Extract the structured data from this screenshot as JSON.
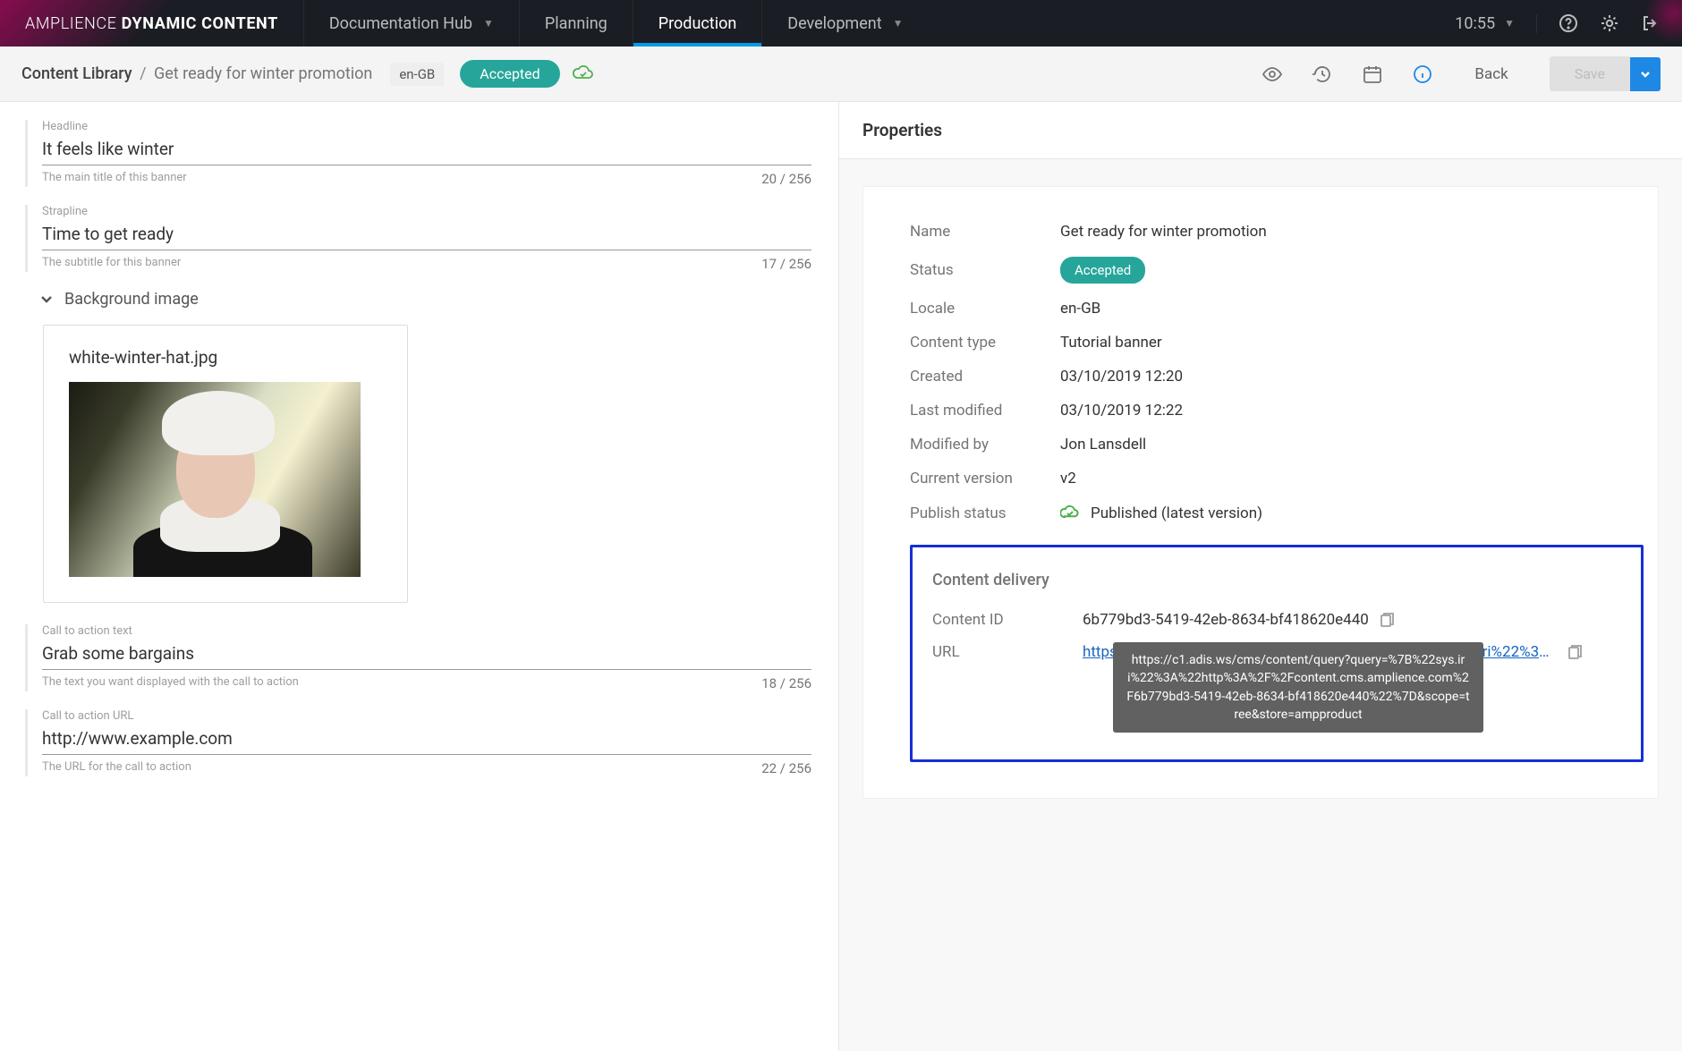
{
  "topnav": {
    "brand_light": "AMPLIENCE",
    "brand_bold": "DYNAMIC CONTENT",
    "items": [
      {
        "label": "Documentation Hub",
        "dropdown": true,
        "active": false
      },
      {
        "label": "Planning",
        "dropdown": false,
        "active": false
      },
      {
        "label": "Production",
        "dropdown": false,
        "active": true
      },
      {
        "label": "Development",
        "dropdown": true,
        "active": false
      }
    ],
    "time": "10:55"
  },
  "subheader": {
    "root": "Content Library",
    "current": "Get ready for winter promotion",
    "locale": "en-GB",
    "status": "Accepted",
    "back_label": "Back",
    "save_label": "Save"
  },
  "form": {
    "headline": {
      "label": "Headline",
      "value": "It feels like winter",
      "help": "The main title of this banner",
      "count": "20 / 256"
    },
    "strapline": {
      "label": "Strapline",
      "value": "Time to get ready",
      "help": "The subtitle for this banner",
      "count": "17 / 256"
    },
    "bgimage": {
      "section_label": "Background image",
      "filename": "white-winter-hat.jpg"
    },
    "cta_text": {
      "label": "Call to action text",
      "value": "Grab some bargains",
      "help": "The text you want displayed with the call to action",
      "count": "18 / 256"
    },
    "cta_url": {
      "label": "Call to action URL",
      "value": "http://www.example.com",
      "help": "The URL for the call to action",
      "count": "22 / 256"
    }
  },
  "properties": {
    "title": "Properties",
    "rows": {
      "name": {
        "k": "Name",
        "v": "Get ready for winter promotion"
      },
      "status": {
        "k": "Status",
        "v": "Accepted"
      },
      "locale": {
        "k": "Locale",
        "v": "en-GB"
      },
      "content_type": {
        "k": "Content type",
        "v": "Tutorial banner"
      },
      "created": {
        "k": "Created",
        "v": "03/10/2019 12:20"
      },
      "last_modified": {
        "k": "Last modified",
        "v": "03/10/2019 12:22"
      },
      "modified_by": {
        "k": "Modified by",
        "v": "Jon Lansdell"
      },
      "current_version": {
        "k": "Current version",
        "v": "v2"
      },
      "publish_status": {
        "k": "Publish status",
        "v": "Published (latest version)"
      }
    },
    "delivery": {
      "title": "Content delivery",
      "content_id": {
        "k": "Content ID",
        "v": "6b779bd3-5419-42eb-8634-bf418620e440"
      },
      "url": {
        "k": "URL",
        "v": "https://c1.adis.ws/cms/content/query?query=%7B%22sys.iri%22%3A..."
      },
      "tooltip": "https://c1.adis.ws/cms/content/query?query=%7B%22sys.iri%22%3A%22http%3A%2F%2Fcontent.cms.amplience.com%2F6b779bd3-5419-42eb-8634-bf418620e440%22%7D&scope=tree&store=ampproduct"
    }
  }
}
